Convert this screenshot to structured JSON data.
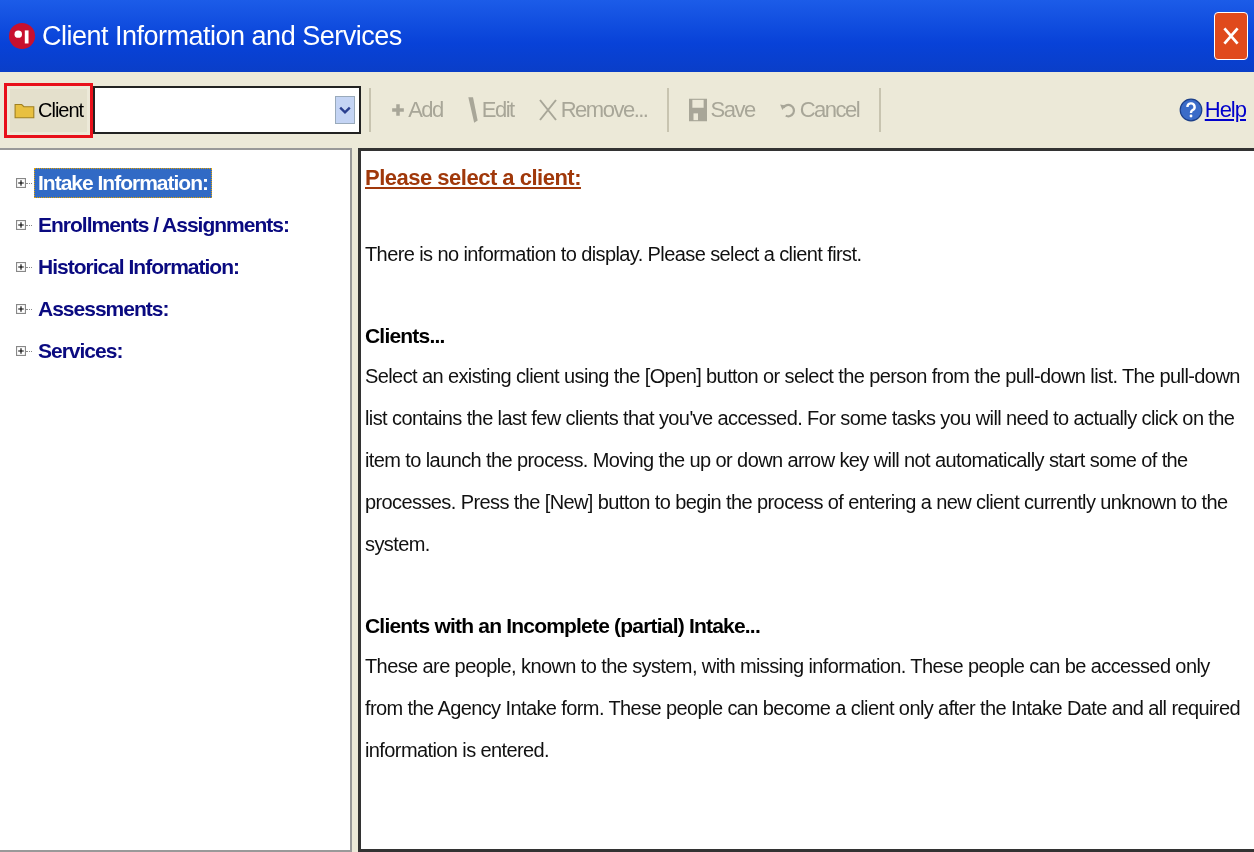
{
  "window": {
    "title": "Client Information and Services"
  },
  "client_selector": {
    "label": "Client",
    "highlighted": true
  },
  "toolbar": [
    {
      "kind": "add",
      "label": "Add",
      "disabled": true
    },
    {
      "kind": "edit",
      "label": "Edit",
      "disabled": true
    },
    {
      "kind": "remove",
      "label": "Remove...",
      "disabled": true
    },
    {
      "kind": "save",
      "label": "Save",
      "disabled": true
    },
    {
      "kind": "cancel",
      "label": "Cancel",
      "disabled": true
    }
  ],
  "help": {
    "label": "Help"
  },
  "tree": [
    {
      "label": "Intake Information:",
      "selected": true,
      "expanded": false
    },
    {
      "label": "Enrollments / Assignments:",
      "selected": false,
      "expanded": false
    },
    {
      "label": "Historical Information:",
      "selected": false,
      "expanded": false
    },
    {
      "label": "Assessments:",
      "selected": false,
      "expanded": false
    },
    {
      "label": "Services:",
      "selected": false,
      "expanded": false
    }
  ],
  "content": {
    "heading": "Please select a client:",
    "intro": "There is no information to display.  Please select a client first.",
    "sections": [
      {
        "title": "Clients...",
        "body": "Select an existing client using the [Open] button or select the person from the pull-down list.  The pull-down list contains the last few clients that you've accessed.  For some tasks you will need to actually click on the item to launch the process.  Moving the up or down arrow key will not automatically start some of the processes.  Press the [New] button to begin the process of entering a new client currently unknown to the system."
      },
      {
        "title": "Clients with an Incomplete (partial) Intake...",
        "body": "These are people, known to the system, with missing information.  These people can be accessed only from the Agency Intake form.  These people can become a client only after the Intake Date and all required information is entered."
      }
    ]
  }
}
